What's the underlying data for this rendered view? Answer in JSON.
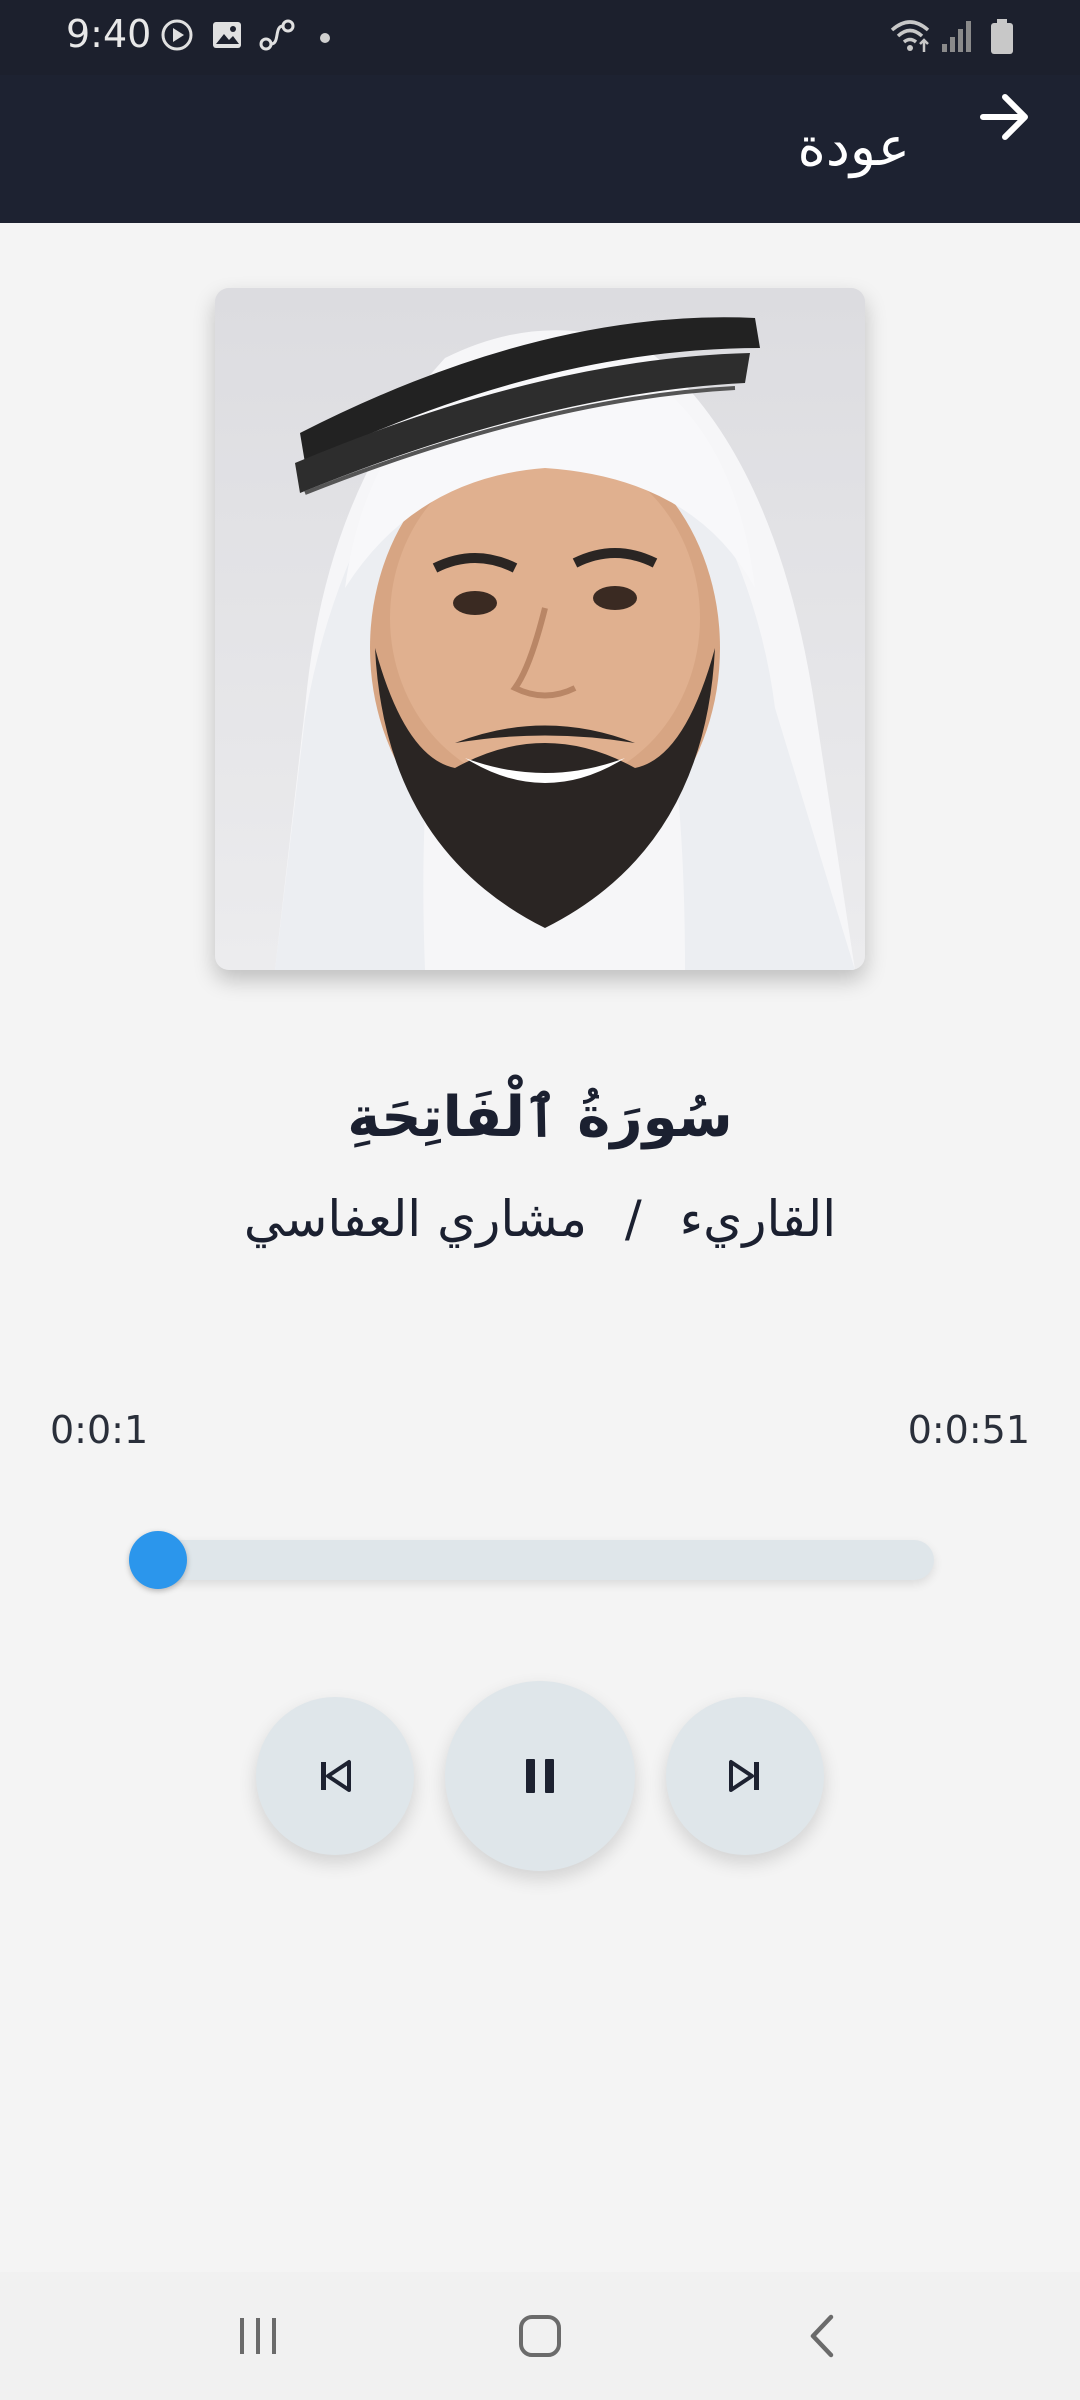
{
  "status_bar": {
    "time": "9:40"
  },
  "app_bar": {
    "back_label": "عودة"
  },
  "track": {
    "title": "سُورَةُ ٱلْفَاتِحَةِ",
    "reciter_label": "القاريء",
    "separator": "/",
    "reciter_name": "مشاري العفاسي"
  },
  "playback": {
    "current_time": "0:0:1",
    "total_time": "0:0:51",
    "progress_fraction": 0.0,
    "is_playing": true
  },
  "colors": {
    "header_bg": "#1d2231",
    "accent": "#2b96ec",
    "button_bg": "#dfe6ea",
    "text_dark": "#1b2030"
  },
  "icons": {
    "prev": "skip-previous-icon",
    "pause": "pause-icon",
    "next": "skip-next-icon",
    "back": "arrow-right-icon"
  }
}
